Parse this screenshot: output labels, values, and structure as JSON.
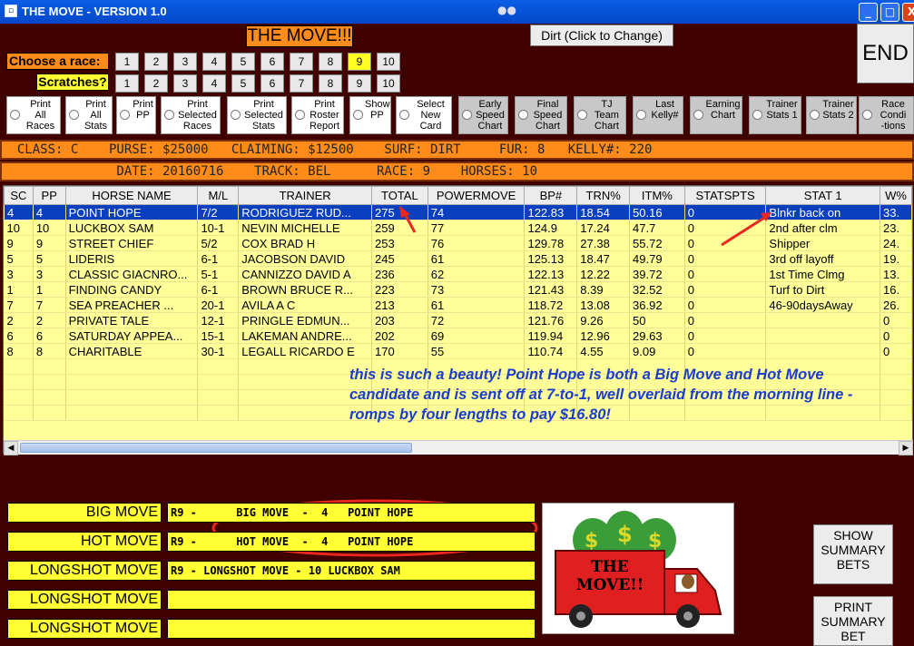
{
  "window": {
    "title": "THE MOVE - VERSION 1.0",
    "min": "_",
    "max": "□",
    "close": "X"
  },
  "header": {
    "app_title": "THE MOVE!!!",
    "surface_button": "Dirt (Click to Change)",
    "end_button": "END"
  },
  "races": {
    "choose_label": "Choose  a race:",
    "scratch_label": "Scratches?",
    "numbers": [
      "1",
      "2",
      "3",
      "4",
      "5",
      "6",
      "7",
      "8",
      "9",
      "10"
    ],
    "selected": "9"
  },
  "options": [
    {
      "label": "Print\nAll\nRaces",
      "gray": false
    },
    {
      "label": "Print\nAll\nStats",
      "gray": false
    },
    {
      "label": "Print\nPP",
      "gray": false
    },
    {
      "label": "Print\nSelected\nRaces",
      "gray": false
    },
    {
      "label": "Print\nSelected\nStats",
      "gray": false
    },
    {
      "label": "Print\nRoster\nReport",
      "gray": false
    },
    {
      "label": "Show\nPP",
      "gray": false
    },
    {
      "label": "Select\nNew\nCard",
      "gray": false
    },
    {
      "label": "Early\nSpeed\nChart",
      "gray": true
    },
    {
      "label": "Final\nSpeed\nChart",
      "gray": true
    },
    {
      "label": "TJ\nTeam\nChart",
      "gray": true
    },
    {
      "label": "Last\nKelly#",
      "gray": true
    },
    {
      "label": "Earning\nChart",
      "gray": true
    },
    {
      "label": "Trainer\nStats 1",
      "gray": true
    },
    {
      "label": "Trainer\nStats 2",
      "gray": true
    },
    {
      "label": "Race\nCondi\n-tions",
      "gray": true
    }
  ],
  "info": {
    "line1": "  CLASS: C    PURSE: $25000   CLAIMING: $12500    SURF: DIRT     FUR: 8   KELLY#: 220",
    "line2": "               DATE: 20160716    TRACK: BEL      RACE: 9    HORSES: 10"
  },
  "table": {
    "columns": [
      "SC",
      "PP",
      "HORSE NAME",
      "M/L",
      "TRAINER",
      "TOTAL",
      "POWERMOVE",
      "BP#",
      "TRN%",
      "ITM%",
      "STATSPTS",
      "STAT 1",
      "W%"
    ],
    "rows": [
      [
        "4",
        "4",
        "POINT HOPE",
        "7/2",
        "RODRIGUEZ RUD...",
        "275",
        "74",
        "122.83",
        "18.54",
        "50.16",
        "0",
        "Blnkr back on",
        "33."
      ],
      [
        "10",
        "10",
        "LUCKBOX SAM",
        "10-1",
        "NEVIN MICHELLE",
        "259",
        "77",
        "124.9",
        "17.24",
        "47.7",
        "0",
        "2nd after clm",
        "23."
      ],
      [
        "9",
        "9",
        "STREET CHIEF",
        "5/2",
        "COX BRAD H",
        "253",
        "76",
        "129.78",
        "27.38",
        "55.72",
        "0",
        "Shipper",
        "24."
      ],
      [
        "5",
        "5",
        "LIDERIS",
        "6-1",
        "JACOBSON DAVID",
        "245",
        "61",
        "125.13",
        "18.47",
        "49.79",
        "0",
        "3rd off layoff",
        "19."
      ],
      [
        "3",
        "3",
        "CLASSIC GIACNRO...",
        "5-1",
        "CANNIZZO DAVID A",
        "236",
        "62",
        "122.13",
        "12.22",
        "39.72",
        "0",
        "1st Time Clmg",
        "13."
      ],
      [
        "1",
        "1",
        "FINDING CANDY",
        "6-1",
        "BROWN BRUCE R...",
        "223",
        "73",
        "121.43",
        "8.39",
        "32.52",
        "0",
        "Turf to Dirt",
        "16."
      ],
      [
        "7",
        "7",
        "SEA PREACHER    ...",
        "20-1",
        "AVILA A C",
        "213",
        "61",
        "118.72",
        "13.08",
        "36.92",
        "0",
        "46-90daysAway",
        "26."
      ],
      [
        "2",
        "2",
        "PRIVATE TALE",
        "12-1",
        "PRINGLE EDMUN...",
        "203",
        "72",
        "121.76",
        "9.26",
        "50",
        "0",
        "",
        "0"
      ],
      [
        "6",
        "6",
        "SATURDAY APPEA...",
        "15-1",
        "LAKEMAN ANDRE...",
        "202",
        "69",
        "119.94",
        "12.96",
        "29.63",
        "0",
        "",
        "0"
      ],
      [
        "8",
        "8",
        "CHARITABLE",
        "30-1",
        "LEGALL RICARDO E",
        "170",
        "55",
        "110.74",
        "4.55",
        "9.09",
        "0",
        "",
        "0"
      ]
    ]
  },
  "note": "this is such a beauty!  Point Hope is both a Big Move and Hot Move candidate and is sent off at 7-to-1, well overlaid from the morning line - romps by four lengths to pay $16.80!",
  "moves": [
    {
      "label": "BIG MOVE",
      "value": "R9 -      BIG MOVE  -  4   POINT HOPE"
    },
    {
      "label": "HOT MOVE",
      "value": "R9 -      HOT MOVE  -  4   POINT HOPE"
    },
    {
      "label": "LONGSHOT MOVE",
      "value": "R9 - LONGSHOT MOVE - 10 LUCKBOX SAM"
    },
    {
      "label": "LONGSHOT MOVE",
      "value": ""
    },
    {
      "label": "LONGSHOT MOVE",
      "value": ""
    }
  ],
  "buttons": {
    "summary": "SHOW\nSUMMARY\nBETS",
    "print_summary": "PRINT\nSUMMARY\nBET\nSHEET"
  },
  "logo_text": "THE MOVE!!",
  "colors": {
    "orange": "#ff8c1a",
    "yellow": "#ffff33",
    "background": "#400000",
    "selected_row": "#0a3fc0",
    "annotation": "#1a3ccf",
    "arrow": "#e8281c"
  }
}
